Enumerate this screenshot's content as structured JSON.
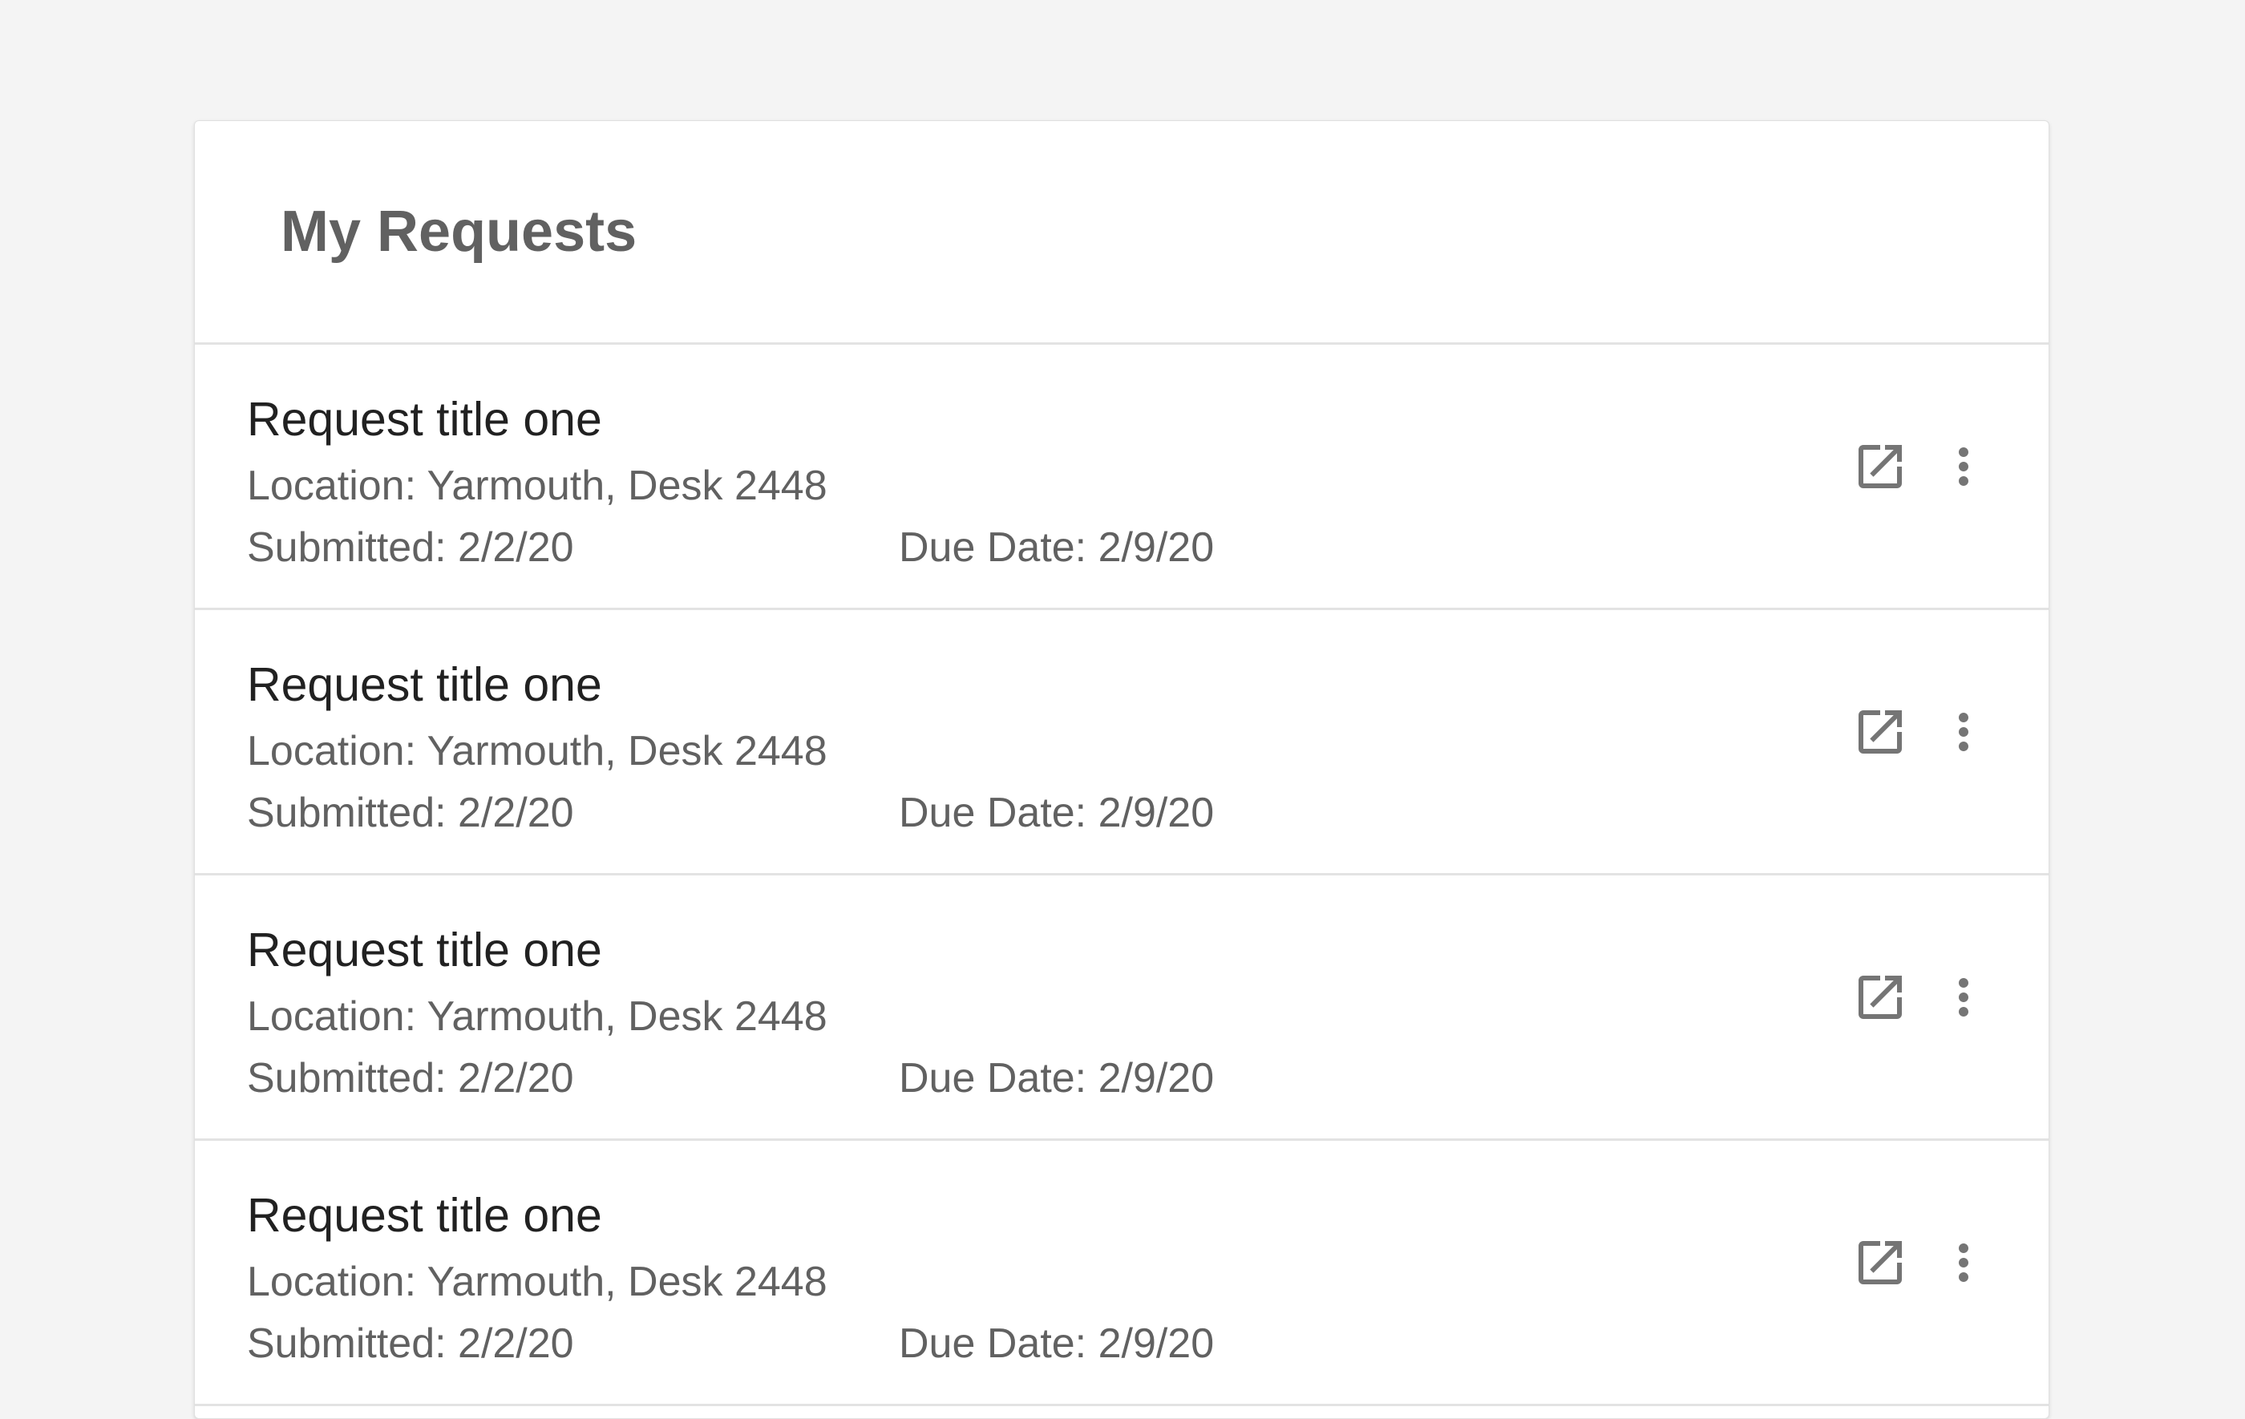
{
  "panel": {
    "title": "My Requests"
  },
  "requests": [
    {
      "title": "Request title one",
      "location": "Location: Yarmouth, Desk 2448",
      "submitted": "Submitted: 2/2/20",
      "due": "Due Date: 2/9/20",
      "open_icon": "open-in-new-icon",
      "menu_icon": "more-vert-icon"
    },
    {
      "title": "Request title one",
      "location": "Location: Yarmouth, Desk 2448",
      "submitted": "Submitted: 2/2/20",
      "due": "Due Date: 2/9/20",
      "open_icon": "open-in-new-icon",
      "menu_icon": "more-vert-icon"
    },
    {
      "title": "Request title one",
      "location": "Location: Yarmouth, Desk 2448",
      "submitted": "Submitted: 2/2/20",
      "due": "Due Date: 2/9/20",
      "open_icon": "open-in-new-icon",
      "menu_icon": "more-vert-icon"
    },
    {
      "title": "Request title one",
      "location": "Location: Yarmouth, Desk 2448",
      "submitted": "Submitted: 2/2/20",
      "due": "Due Date: 2/9/20",
      "open_icon": "open-in-new-icon",
      "menu_icon": "more-vert-icon"
    }
  ],
  "colors": {
    "background": "#f4f4f4",
    "card": "#ffffff",
    "title_text": "#616161",
    "primary_text": "#212121",
    "secondary_text": "#616161",
    "icon": "#757575",
    "divider": "#e3e3e3"
  }
}
